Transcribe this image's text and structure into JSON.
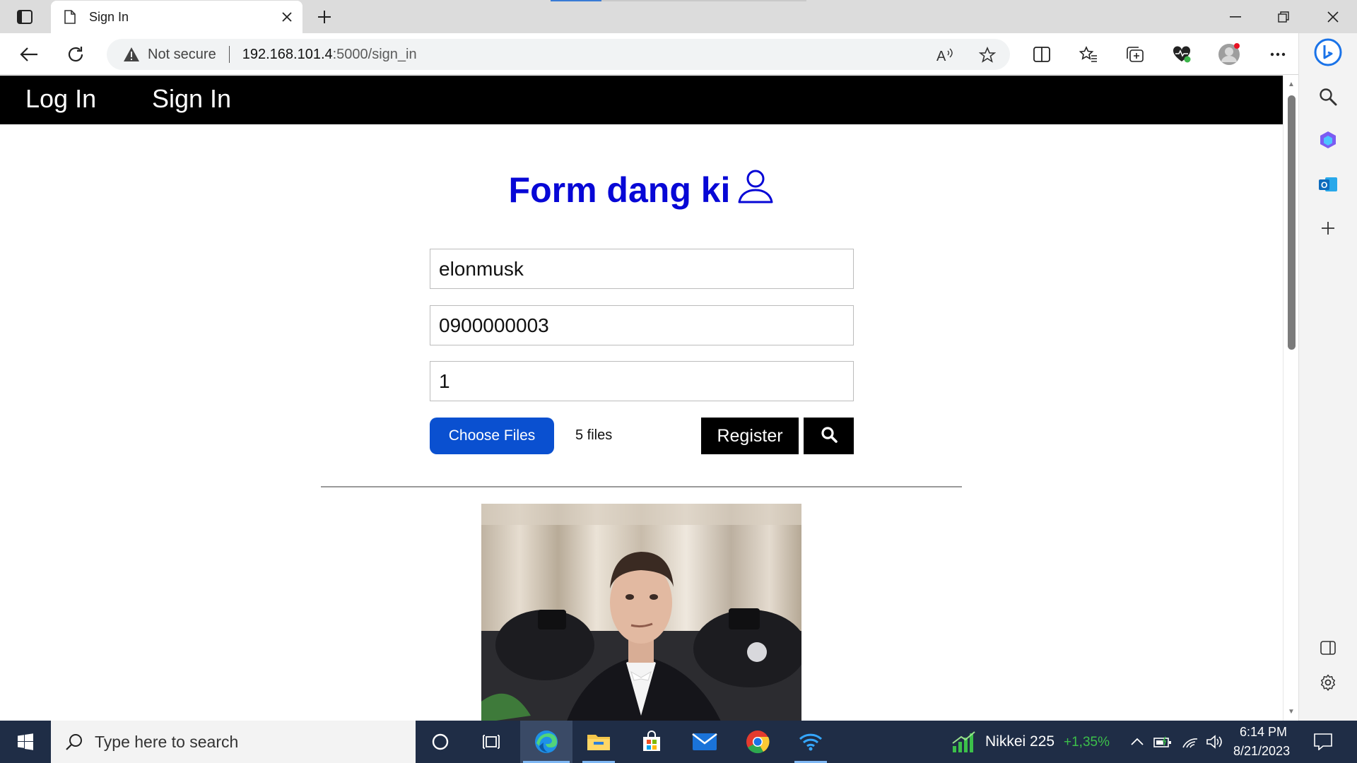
{
  "browser": {
    "tab_title": "Sign In",
    "security_label": "Not secure",
    "url_host": "192.168.101.4",
    "url_path": ":5000/sign_in"
  },
  "site_nav": {
    "links": [
      {
        "label": "Log In"
      },
      {
        "label": "Sign In"
      }
    ]
  },
  "form": {
    "title": "Form dang ki",
    "title_icon": "user-outline-icon",
    "title_color": "#0707d6",
    "fields": [
      {
        "value": "elonmusk"
      },
      {
        "value": "0900000003"
      },
      {
        "value": "1"
      }
    ],
    "choose_files_label": "Choose Files",
    "files_status": "5 files",
    "register_label": "Register",
    "search_icon": "search-icon"
  },
  "colors": {
    "accent_button": "#0a50d0",
    "nav_background": "#000000",
    "taskbar": "#1f2d46"
  },
  "taskbar": {
    "search_placeholder": "Type here to search",
    "stock_name": "Nikkei 225",
    "stock_change": "+1,35%",
    "stock_change_color": "#3cc04a",
    "time": "6:14 PM",
    "date": "8/21/2023"
  }
}
